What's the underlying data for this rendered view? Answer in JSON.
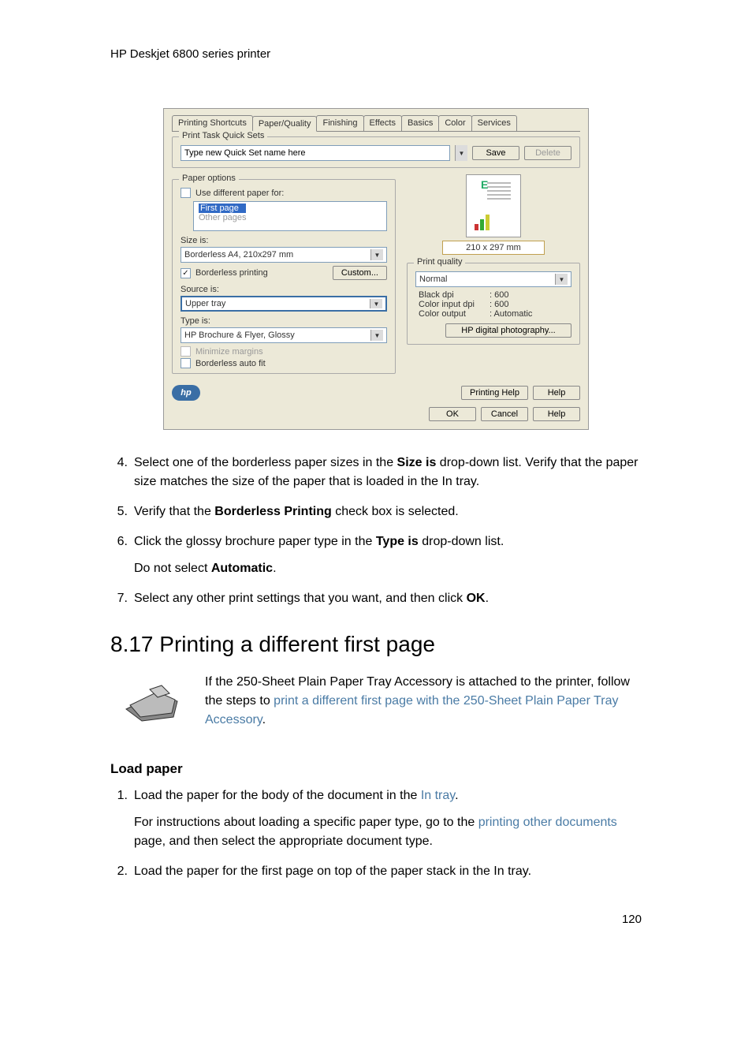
{
  "header": {
    "title": "HP Deskjet 6800 series printer"
  },
  "dialog": {
    "tabs": [
      "Printing Shortcuts",
      "Paper/Quality",
      "Finishing",
      "Effects",
      "Basics",
      "Color",
      "Services"
    ],
    "active_tab": "Paper/Quality",
    "ptqs": {
      "legend": "Print Task Quick Sets",
      "input_value": "Type new Quick Set name here",
      "save": "Save",
      "delete": "Delete"
    },
    "paper_options": {
      "legend": "Paper options",
      "use_diff": "Use different paper for:",
      "first_page": "First page",
      "other_pages": "Other pages",
      "size_label": "Size is:",
      "size_value": "Borderless A4, 210x297 mm",
      "borderless_printing": "Borderless printing",
      "custom": "Custom...",
      "source_label": "Source is:",
      "source_value": "Upper tray",
      "type_label": "Type is:",
      "type_value": "HP Brochure & Flyer, Glossy",
      "minimize_margins": "Minimize margins",
      "borderless_autofit": "Borderless auto fit"
    },
    "preview": {
      "dimensions": "210 x 297 mm"
    },
    "print_quality": {
      "legend": "Print quality",
      "value": "Normal",
      "black_dpi_label": "Black dpi",
      "black_dpi": ": 600",
      "color_input_dpi_label": "Color input dpi",
      "color_input_dpi": ": 600",
      "color_output_label": "Color output",
      "color_output": ": Automatic",
      "hp_digital": "HP digital photography..."
    },
    "printing_help": "Printing Help",
    "help": "Help",
    "ok": "OK",
    "cancel": "Cancel",
    "help2": "Help",
    "hp_logo": "hp"
  },
  "steps1": {
    "s4a": "Select one of the borderless paper sizes in the ",
    "s4b": "Size is",
    "s4c": " drop-down list. Verify that the paper size matches the size of the paper that is loaded in the In tray.",
    "s5a": "Verify that the ",
    "s5b": "Borderless Printing",
    "s5c": " check box is selected.",
    "s6a": "Click the glossy brochure paper type in the ",
    "s6b": "Type is",
    "s6c": " drop-down list.",
    "s6d": "Do not select ",
    "s6e": "Automatic",
    "s6f": ".",
    "s7a": "Select any other print settings that you want, and then click ",
    "s7b": "OK",
    "s7c": "."
  },
  "section": {
    "heading": "8.17  Printing a different first page"
  },
  "callout": {
    "text1": "If the 250-Sheet Plain Paper Tray Accessory is attached to the printer, follow the steps to ",
    "link1": "print a different first page with the 250-Sheet Plain Paper Tray Accessory",
    "text2": "."
  },
  "subheading": "Load paper",
  "steps2": {
    "s1a": "Load the paper for the body of the document in the ",
    "s1b": "In tray",
    "s1c": ".",
    "s1d": "For instructions about loading a specific paper type, go to the ",
    "s1e": "printing other documents",
    "s1f": " page, and then select the appropriate document type.",
    "s2": "Load the paper for the first page on top of the paper stack in the In tray."
  },
  "page_num": "120"
}
